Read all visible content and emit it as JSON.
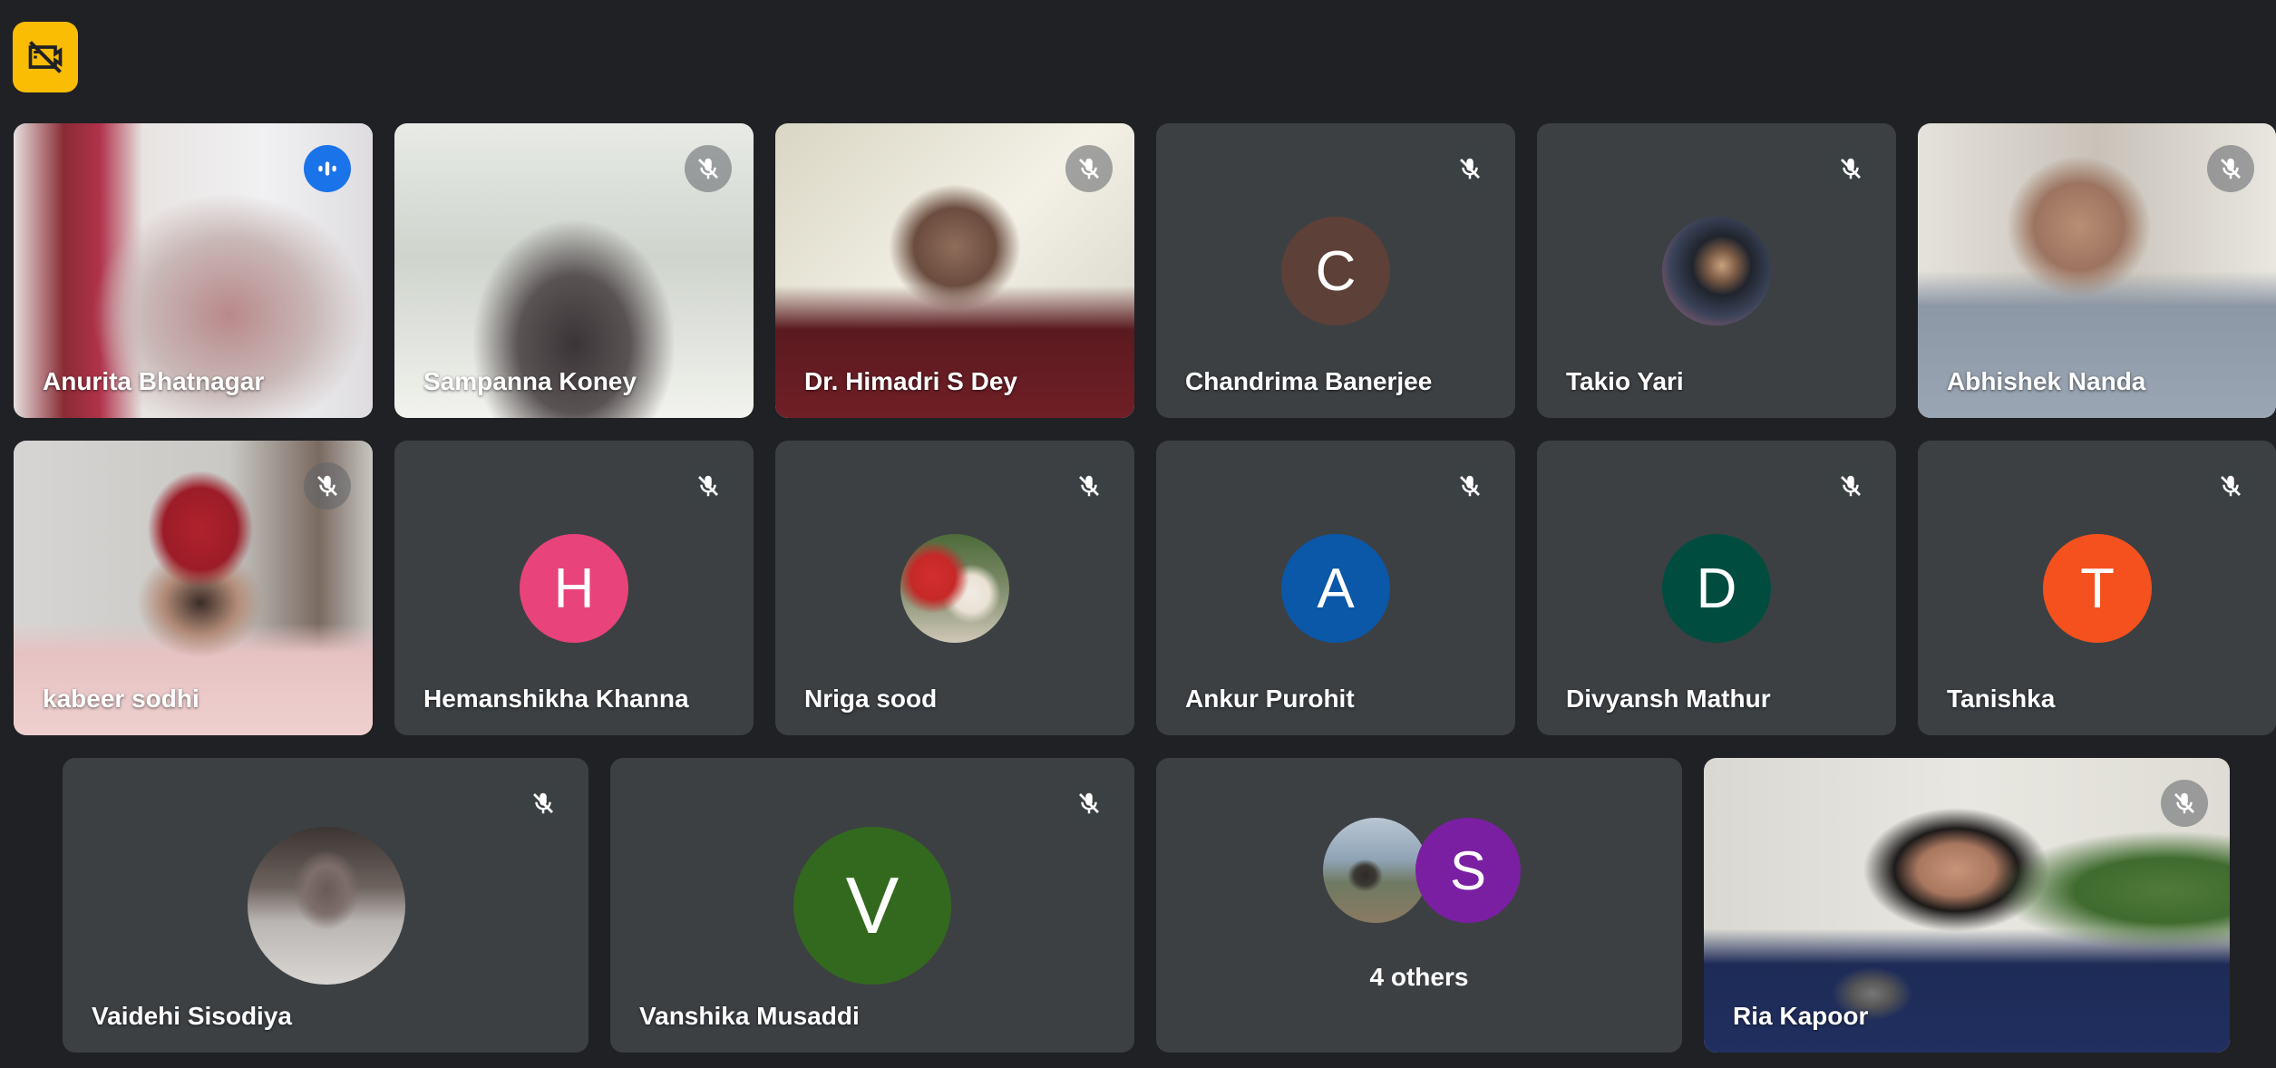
{
  "meeting": {
    "badge_icon": "camera-off-icon",
    "colors": {
      "background": "#202124",
      "tile": "#3c4043",
      "speaking_border": "#8ab4f8",
      "badge": "#fbbc04"
    }
  },
  "participants": [
    {
      "name": "Anurita Bhatnagar",
      "status": "speaking",
      "view": "video"
    },
    {
      "name": "Sampanna Koney",
      "status": "muted",
      "view": "video"
    },
    {
      "name": "Dr. Himadri S Dey",
      "status": "muted",
      "view": "video"
    },
    {
      "name": "Chandrima Banerjee",
      "status": "muted",
      "view": "avatar",
      "initial": "C",
      "color": "#5d4037"
    },
    {
      "name": "Takio Yari",
      "status": "muted",
      "view": "photo-avatar"
    },
    {
      "name": "Abhishek Nanda",
      "status": "muted",
      "view": "video"
    },
    {
      "name": "kabeer sodhi",
      "status": "muted",
      "view": "video"
    },
    {
      "name": "Hemanshikha Khanna",
      "status": "muted",
      "view": "avatar",
      "initial": "H",
      "color": "#e8437a"
    },
    {
      "name": "Nriga sood",
      "status": "muted",
      "view": "photo-avatar"
    },
    {
      "name": "Ankur Purohit",
      "status": "muted",
      "view": "avatar",
      "initial": "A",
      "color": "#0b57a8"
    },
    {
      "name": "Divyansh Mathur",
      "status": "muted",
      "view": "avatar",
      "initial": "D",
      "color": "#004d40"
    },
    {
      "name": "Tanishka",
      "status": "muted",
      "view": "avatar",
      "initial": "T",
      "color": "#f4511e"
    },
    {
      "name": "Vaidehi Sisodiya",
      "status": "muted",
      "view": "photo-avatar"
    },
    {
      "name": "Vanshika Musaddi",
      "status": "muted",
      "view": "avatar",
      "initial": "V",
      "color": "#33691e"
    },
    {
      "name": "Ria Kapoor",
      "status": "muted",
      "view": "video"
    }
  ],
  "others": {
    "label": "4 others",
    "initial": "S",
    "color": "#7b1fa2"
  }
}
